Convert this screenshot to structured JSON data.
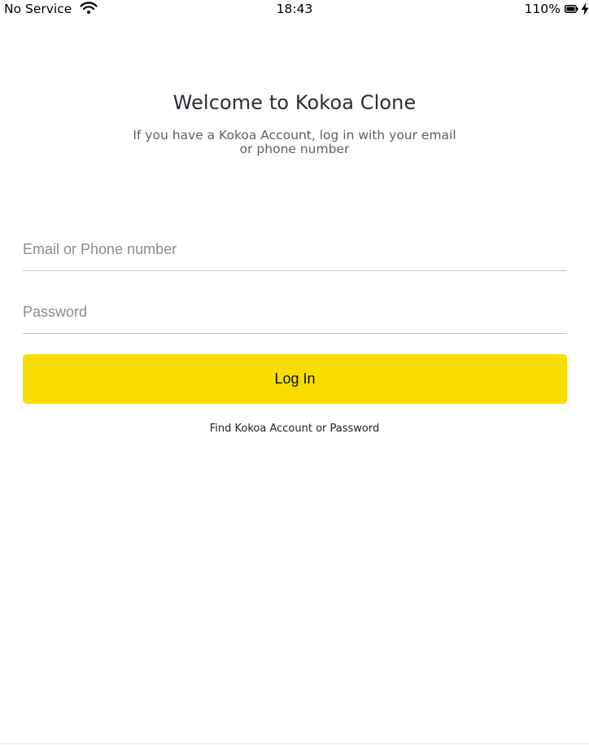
{
  "status_bar": {
    "carrier": "No Service",
    "time": "18:43",
    "battery_percent": "110%",
    "wifi_icon": "wifi-icon",
    "battery_icon": "battery-icon",
    "charging_icon": "bolt-icon"
  },
  "header": {
    "title": "Welcome to Kokoa Clone",
    "subtitle": "If you have a Kokoa Account, log in with your email or phone number"
  },
  "form": {
    "email_placeholder": "Email or Phone number",
    "email_value": "",
    "password_placeholder": "Password",
    "password_value": "",
    "login_label": "Log In",
    "find_account_label": "Find Kokoa Account or Password"
  },
  "colors": {
    "accent": "#f9dd00",
    "divider": "#c6c6c6",
    "title_text": "#2a2e35",
    "subtitle_text": "#5b5f66"
  }
}
